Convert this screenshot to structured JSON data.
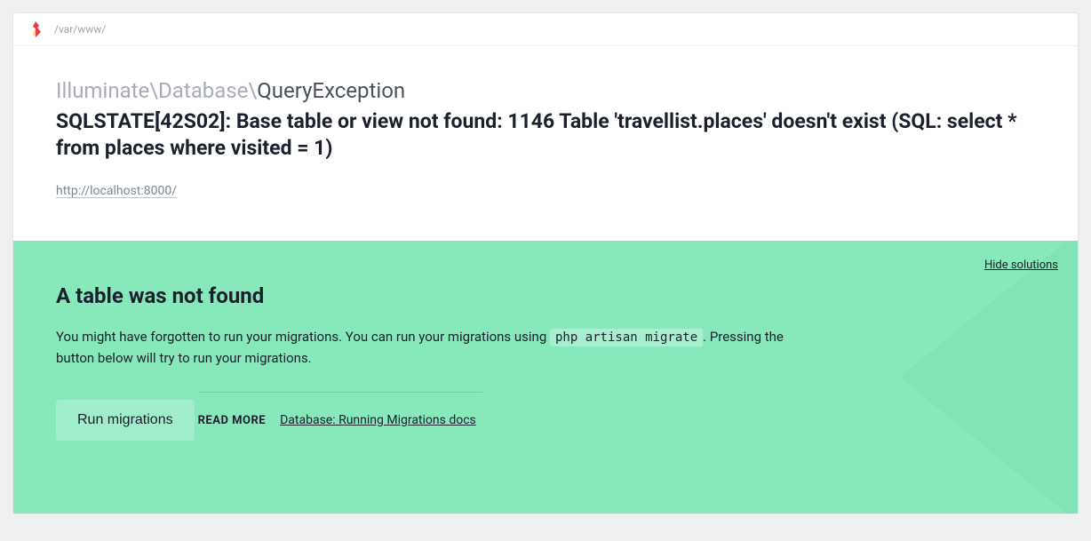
{
  "header": {
    "breadcrumb": "/var/www/"
  },
  "error": {
    "namespace": "Illuminate\\Database\\",
    "class": "QueryException",
    "message": "SQLSTATE[42S02]: Base table or view not found: 1146 Table 'travellist.places' doesn't exist (SQL: select * from places where visited = 1)",
    "url": "http://localhost:8000/"
  },
  "solution": {
    "hide_label": "Hide solutions",
    "title": "A table was not found",
    "text_before": "You might have forgotten to run your migrations. You can run your migrations using ",
    "command": "php artisan migrate",
    "text_after": ". Pressing the button below will try to run your migrations.",
    "button_label": "Run migrations",
    "readmore_label": "READ MORE",
    "readmore_link": "Database: Running Migrations docs"
  }
}
